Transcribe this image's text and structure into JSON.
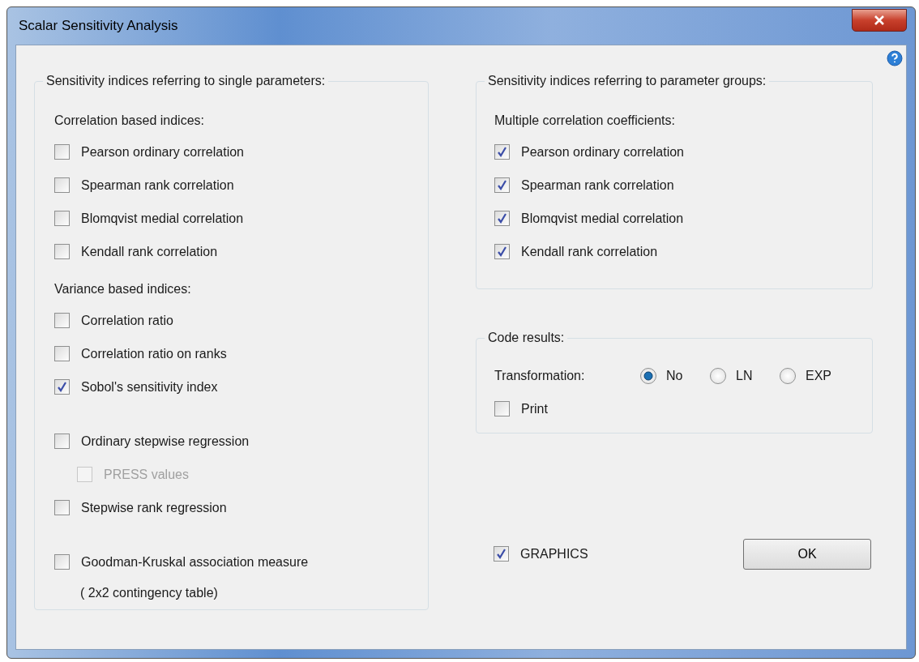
{
  "window": {
    "title": "Scalar Sensitivity Analysis"
  },
  "single": {
    "title": "Sensitivity indices referring to single parameters:",
    "groups": [
      {
        "heading": "Correlation based indices:",
        "items": [
          {
            "label": "Pearson ordinary correlation",
            "checked": false,
            "disabled": false
          },
          {
            "label": "Spearman rank correlation",
            "checked": false,
            "disabled": false
          },
          {
            "label": "Blomqvist medial correlation",
            "checked": false,
            "disabled": false
          },
          {
            "label": "Kendall rank correlation",
            "checked": false,
            "disabled": false
          }
        ]
      },
      {
        "heading": "Variance based indices:",
        "items": [
          {
            "label": "Correlation ratio",
            "checked": false,
            "disabled": false
          },
          {
            "label": "Correlation ratio on ranks",
            "checked": false,
            "disabled": false
          },
          {
            "label": "Sobol's sensitivity index",
            "checked": true,
            "disabled": false
          }
        ]
      },
      {
        "items": [
          {
            "label": "Ordinary stepwise regression",
            "checked": false,
            "disabled": false,
            "children": [
              {
                "label": "PRESS values",
                "checked": false,
                "disabled": true
              }
            ]
          },
          {
            "label": "Stepwise rank regression",
            "checked": false,
            "disabled": false
          }
        ]
      },
      {
        "items": [
          {
            "label": "Goodman-Kruskal association measure",
            "checked": false,
            "disabled": false,
            "note": "( 2x2 contingency table)"
          }
        ]
      }
    ]
  },
  "groups": {
    "title": "Sensitivity indices referring to parameter groups:",
    "heading": "Multiple correlation coefficients:",
    "items": [
      {
        "label": "Pearson ordinary correlation",
        "checked": true,
        "disabled": false
      },
      {
        "label": "Spearman rank correlation",
        "checked": true,
        "disabled": false
      },
      {
        "label": "Blomqvist medial correlation",
        "checked": true,
        "disabled": false
      },
      {
        "label": "Kendall rank correlation",
        "checked": true,
        "disabled": false
      }
    ]
  },
  "code_results": {
    "title": "Code results:",
    "transformation_label": "Transformation:",
    "options": [
      {
        "label": "No",
        "selected": true
      },
      {
        "label": "LN",
        "selected": false
      },
      {
        "label": "EXP",
        "selected": false
      }
    ],
    "print": {
      "label": "Print",
      "checked": false,
      "disabled": false
    }
  },
  "graphics": {
    "label": "GRAPHICS",
    "checked": true,
    "disabled": false
  },
  "buttons": [
    "OK"
  ]
}
